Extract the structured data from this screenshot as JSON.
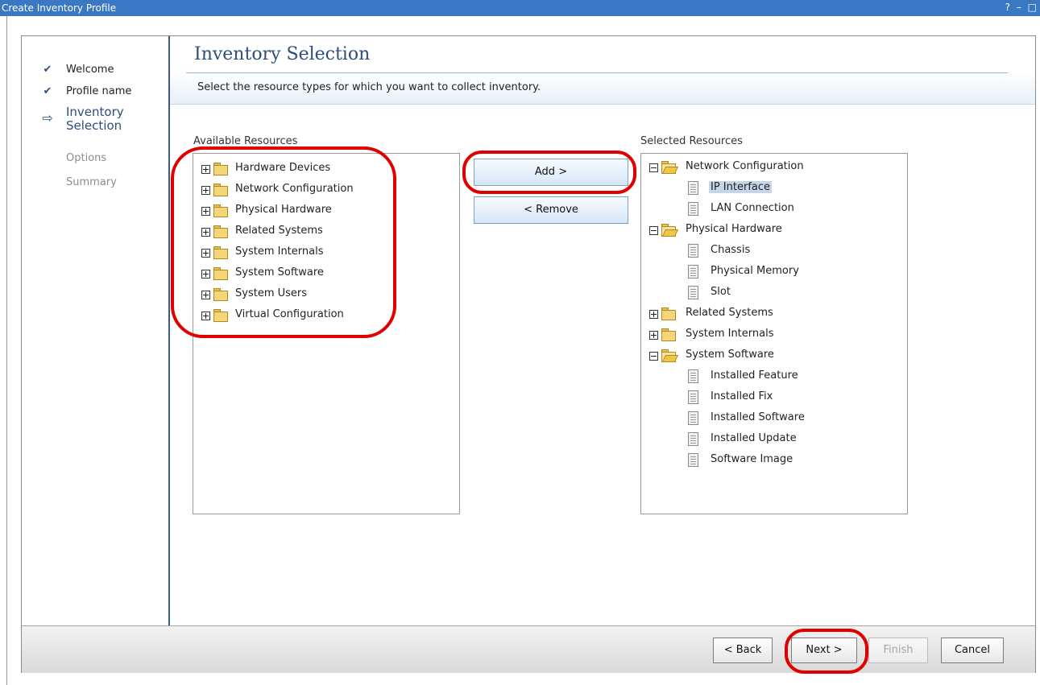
{
  "window": {
    "title": "Create Inventory Profile",
    "controls": [
      "?",
      "–",
      "□"
    ]
  },
  "steps": [
    {
      "label": "Welcome",
      "state": "done"
    },
    {
      "label": "Profile name",
      "state": "done"
    },
    {
      "label": "Inventory Selection",
      "label_line1": "Inventory",
      "label_line2": "Selection",
      "state": "current"
    },
    {
      "label": "Options",
      "state": "inactive"
    },
    {
      "label": "Summary",
      "state": "inactive"
    }
  ],
  "page": {
    "title": "Inventory Selection",
    "description": "Select the resource types for which you want to collect inventory."
  },
  "available": {
    "label": "Available Resources",
    "items": [
      "Hardware Devices",
      "Network Configuration",
      "Physical Hardware",
      "Related Systems",
      "System Internals",
      "System Software",
      "System Users",
      "Virtual Configuration"
    ]
  },
  "selected": {
    "label": "Selected Resources",
    "groups": [
      {
        "label": "Network Configuration",
        "expanded": true,
        "children": [
          "IP Interface",
          "LAN Connection"
        ]
      },
      {
        "label": "Physical Hardware",
        "expanded": true,
        "children": [
          "Chassis",
          "Physical Memory",
          "Slot"
        ]
      },
      {
        "label": "Related Systems",
        "expanded": false,
        "children": []
      },
      {
        "label": "System Internals",
        "expanded": false,
        "children": []
      },
      {
        "label": "System Software",
        "expanded": true,
        "children": [
          "Installed Feature",
          "Installed Fix",
          "Installed Software",
          "Installed Update",
          "Software Image"
        ]
      }
    ],
    "highlighted_item": "IP Interface"
  },
  "buttons": {
    "add": "Add >",
    "remove": "< Remove",
    "back": "< Back",
    "next": "Next >",
    "finish": "Finish",
    "cancel": "Cancel"
  },
  "icons": {
    "done_step": "checkmark-icon",
    "current_step": "arrow-right-icon",
    "closed_folder": "folder-icon",
    "open_folder": "folder-open-icon",
    "leaf": "document-icon",
    "expand": "plus-box-icon",
    "collapse": "minus-box-icon"
  },
  "colors": {
    "titlebar": "#3a78c4",
    "accent": "#2b4e7e",
    "callout": "#e00000"
  }
}
